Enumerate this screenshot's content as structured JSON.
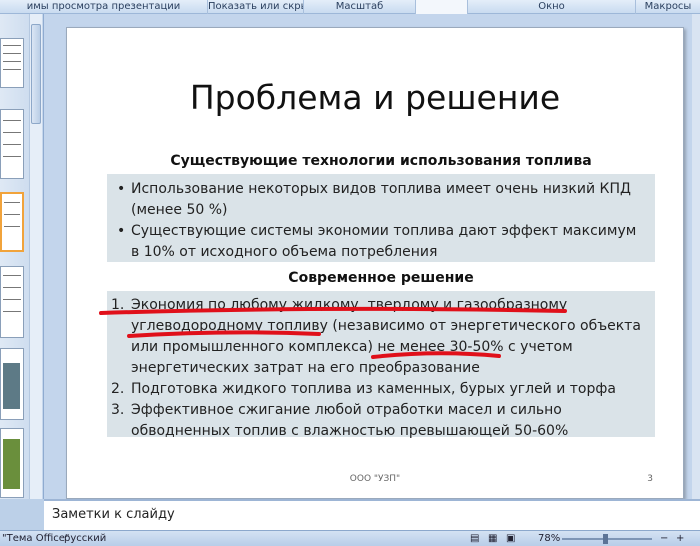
{
  "ribbon": {
    "groups": [
      "имы просмотра презентации",
      "Показать или скрыть",
      "Масштаб",
      "Окно",
      "Макросы"
    ]
  },
  "slide": {
    "title": "Проблема и решение",
    "section1_heading": "Существующие технологии использования топлива",
    "section1_bullets": [
      "Использование некоторых видов топлива имеет очень низкий КПД (менее 50 %)",
      "Существующие системы экономии топлива дают эффект максимум в 10% от исходного объема потребления"
    ],
    "section2_heading": "Современное решение",
    "section2_items": [
      {
        "num": "1.",
        "text": "Экономия по любому жидкому, твердому и газообразному углеводородному топливу (независимо от энергетического объекта или промышленного комплекса) не менее 30-50% с учетом энергетических затрат на его преобразование"
      },
      {
        "num": "2.",
        "text": "Подготовка жидкого топлива из каменных, бурых углей и торфа"
      },
      {
        "num": "3.",
        "text": "Эффективное сжигание любой отработки масел и сильно обводненных топлив с влажностью превышающей 50-60%"
      }
    ],
    "footer": "ООО \"УЗП\"",
    "page_number": "3",
    "annotation_color": "#e0101a"
  },
  "notes": {
    "placeholder": "Заметки к слайду"
  },
  "status": {
    "theme": "\"Тема Office\"",
    "language": "русский",
    "zoom": "78%"
  }
}
